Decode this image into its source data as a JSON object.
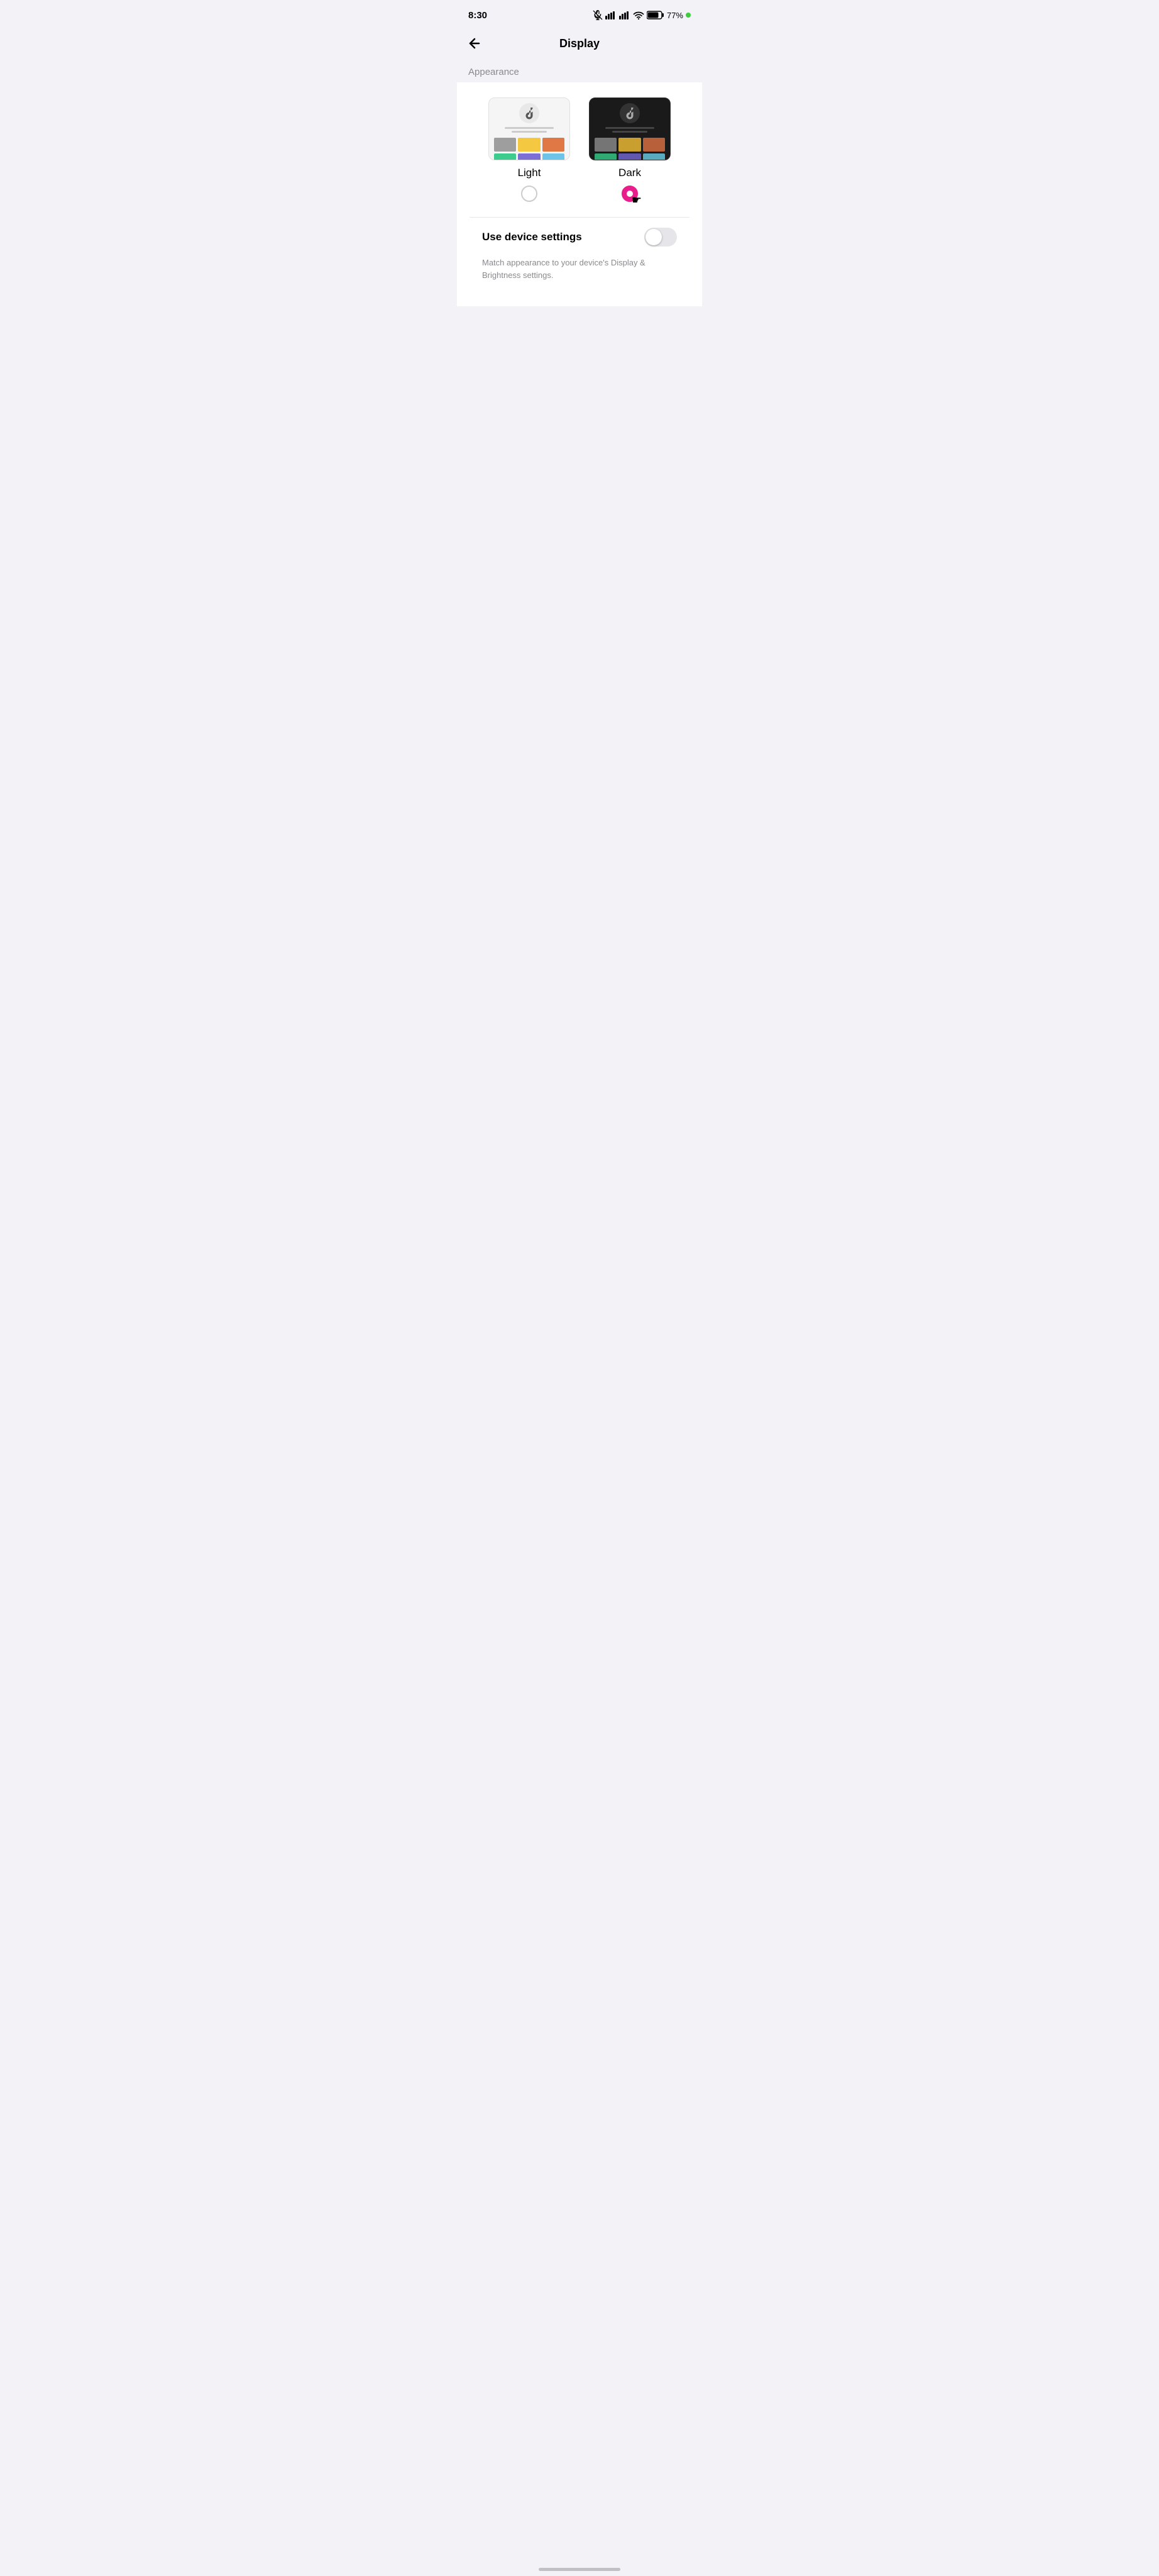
{
  "statusBar": {
    "time": "8:30",
    "battery": "77%"
  },
  "header": {
    "back_label": "←",
    "title": "Display"
  },
  "appearance": {
    "section_label": "Appearance",
    "light_label": "Light",
    "dark_label": "Dark",
    "light_selected": false,
    "dark_selected": true,
    "device_settings_label": "Use device settings",
    "device_settings_desc": "Match appearance to your device's Display & Brightness settings.",
    "device_settings_enabled": false,
    "grid_colors": {
      "row1": [
        "#9e9e9e",
        "#f5c842",
        "#e07845"
      ],
      "row2": [
        "#3dcc8e",
        "#7c6fd4",
        "#6ec4e8"
      ]
    }
  }
}
